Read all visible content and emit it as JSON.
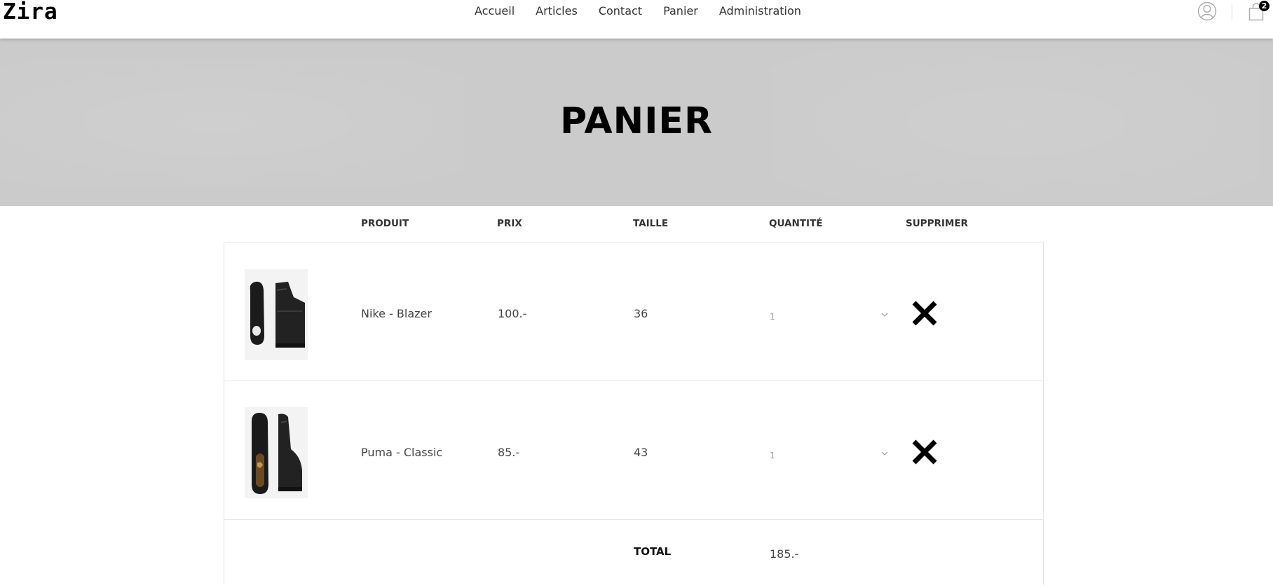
{
  "header": {
    "logo": "Zira",
    "nav": [
      "Accueil",
      "Articles",
      "Contact",
      "Panier",
      "Administration"
    ],
    "user_icon": "user-circle-icon",
    "cart_icon": "shopping-bag-icon",
    "cart_count": "2"
  },
  "banner": {
    "title": "PANIER"
  },
  "table": {
    "headers": {
      "product": "PRODUIT",
      "price": "PRIX",
      "size": "TAILLE",
      "quantity": "QUANTITÉ",
      "remove": "SUPPRIMER"
    },
    "rows": [
      {
        "name": "Nike - Blazer",
        "price": "100.-",
        "size": "36",
        "quantity": "1",
        "image": "black high-top sneaker",
        "remove_icon": "close-icon"
      },
      {
        "name": "Puma - Classic",
        "price": "85.-",
        "size": "43",
        "quantity": "1",
        "image": "black low-top sneaker",
        "remove_icon": "close-icon"
      }
    ],
    "total_label": "TOTAL",
    "total_value": "185.-"
  }
}
